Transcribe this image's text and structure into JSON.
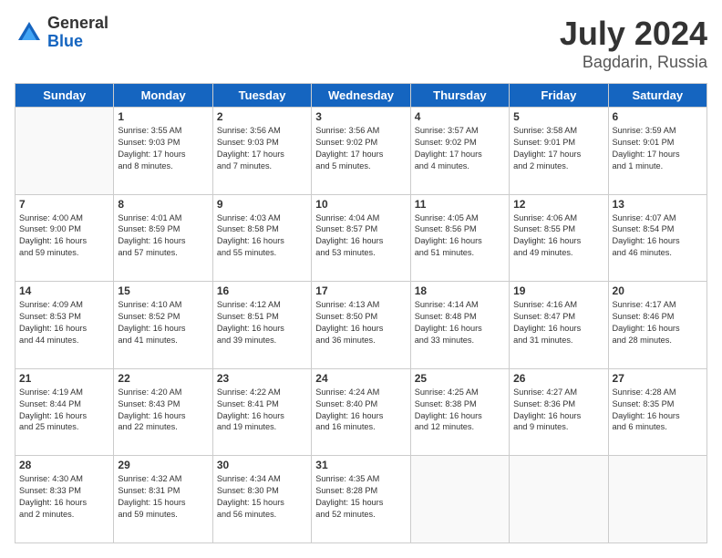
{
  "header": {
    "logo_general": "General",
    "logo_blue": "Blue",
    "month": "July 2024",
    "location": "Bagdarin, Russia"
  },
  "weekdays": [
    "Sunday",
    "Monday",
    "Tuesday",
    "Wednesday",
    "Thursday",
    "Friday",
    "Saturday"
  ],
  "cells": [
    {
      "day": "",
      "text": ""
    },
    {
      "day": "1",
      "text": "Sunrise: 3:55 AM\nSunset: 9:03 PM\nDaylight: 17 hours\nand 8 minutes."
    },
    {
      "day": "2",
      "text": "Sunrise: 3:56 AM\nSunset: 9:03 PM\nDaylight: 17 hours\nand 7 minutes."
    },
    {
      "day": "3",
      "text": "Sunrise: 3:56 AM\nSunset: 9:02 PM\nDaylight: 17 hours\nand 5 minutes."
    },
    {
      "day": "4",
      "text": "Sunrise: 3:57 AM\nSunset: 9:02 PM\nDaylight: 17 hours\nand 4 minutes."
    },
    {
      "day": "5",
      "text": "Sunrise: 3:58 AM\nSunset: 9:01 PM\nDaylight: 17 hours\nand 2 minutes."
    },
    {
      "day": "6",
      "text": "Sunrise: 3:59 AM\nSunset: 9:01 PM\nDaylight: 17 hours\nand 1 minute."
    },
    {
      "day": "7",
      "text": "Sunrise: 4:00 AM\nSunset: 9:00 PM\nDaylight: 16 hours\nand 59 minutes."
    },
    {
      "day": "8",
      "text": "Sunrise: 4:01 AM\nSunset: 8:59 PM\nDaylight: 16 hours\nand 57 minutes."
    },
    {
      "day": "9",
      "text": "Sunrise: 4:03 AM\nSunset: 8:58 PM\nDaylight: 16 hours\nand 55 minutes."
    },
    {
      "day": "10",
      "text": "Sunrise: 4:04 AM\nSunset: 8:57 PM\nDaylight: 16 hours\nand 53 minutes."
    },
    {
      "day": "11",
      "text": "Sunrise: 4:05 AM\nSunset: 8:56 PM\nDaylight: 16 hours\nand 51 minutes."
    },
    {
      "day": "12",
      "text": "Sunrise: 4:06 AM\nSunset: 8:55 PM\nDaylight: 16 hours\nand 49 minutes."
    },
    {
      "day": "13",
      "text": "Sunrise: 4:07 AM\nSunset: 8:54 PM\nDaylight: 16 hours\nand 46 minutes."
    },
    {
      "day": "14",
      "text": "Sunrise: 4:09 AM\nSunset: 8:53 PM\nDaylight: 16 hours\nand 44 minutes."
    },
    {
      "day": "15",
      "text": "Sunrise: 4:10 AM\nSunset: 8:52 PM\nDaylight: 16 hours\nand 41 minutes."
    },
    {
      "day": "16",
      "text": "Sunrise: 4:12 AM\nSunset: 8:51 PM\nDaylight: 16 hours\nand 39 minutes."
    },
    {
      "day": "17",
      "text": "Sunrise: 4:13 AM\nSunset: 8:50 PM\nDaylight: 16 hours\nand 36 minutes."
    },
    {
      "day": "18",
      "text": "Sunrise: 4:14 AM\nSunset: 8:48 PM\nDaylight: 16 hours\nand 33 minutes."
    },
    {
      "day": "19",
      "text": "Sunrise: 4:16 AM\nSunset: 8:47 PM\nDaylight: 16 hours\nand 31 minutes."
    },
    {
      "day": "20",
      "text": "Sunrise: 4:17 AM\nSunset: 8:46 PM\nDaylight: 16 hours\nand 28 minutes."
    },
    {
      "day": "21",
      "text": "Sunrise: 4:19 AM\nSunset: 8:44 PM\nDaylight: 16 hours\nand 25 minutes."
    },
    {
      "day": "22",
      "text": "Sunrise: 4:20 AM\nSunset: 8:43 PM\nDaylight: 16 hours\nand 22 minutes."
    },
    {
      "day": "23",
      "text": "Sunrise: 4:22 AM\nSunset: 8:41 PM\nDaylight: 16 hours\nand 19 minutes."
    },
    {
      "day": "24",
      "text": "Sunrise: 4:24 AM\nSunset: 8:40 PM\nDaylight: 16 hours\nand 16 minutes."
    },
    {
      "day": "25",
      "text": "Sunrise: 4:25 AM\nSunset: 8:38 PM\nDaylight: 16 hours\nand 12 minutes."
    },
    {
      "day": "26",
      "text": "Sunrise: 4:27 AM\nSunset: 8:36 PM\nDaylight: 16 hours\nand 9 minutes."
    },
    {
      "day": "27",
      "text": "Sunrise: 4:28 AM\nSunset: 8:35 PM\nDaylight: 16 hours\nand 6 minutes."
    },
    {
      "day": "28",
      "text": "Sunrise: 4:30 AM\nSunset: 8:33 PM\nDaylight: 16 hours\nand 2 minutes."
    },
    {
      "day": "29",
      "text": "Sunrise: 4:32 AM\nSunset: 8:31 PM\nDaylight: 15 hours\nand 59 minutes."
    },
    {
      "day": "30",
      "text": "Sunrise: 4:34 AM\nSunset: 8:30 PM\nDaylight: 15 hours\nand 56 minutes."
    },
    {
      "day": "31",
      "text": "Sunrise: 4:35 AM\nSunset: 8:28 PM\nDaylight: 15 hours\nand 52 minutes."
    },
    {
      "day": "",
      "text": ""
    },
    {
      "day": "",
      "text": ""
    },
    {
      "day": "",
      "text": ""
    }
  ]
}
